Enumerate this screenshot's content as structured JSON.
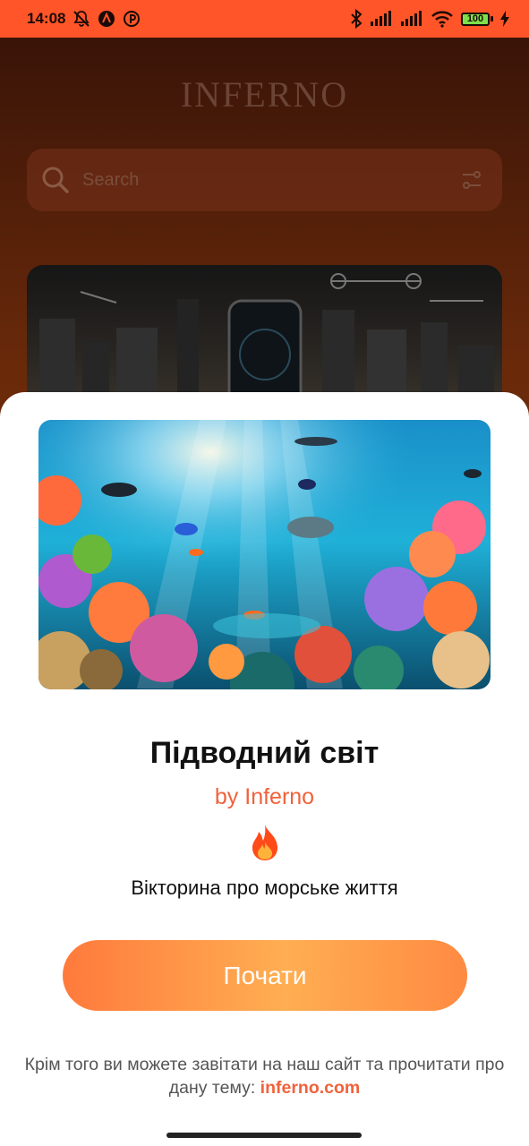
{
  "status_bar": {
    "time": "14:08",
    "battery": "100",
    "icons": [
      "mute-bell-icon",
      "alert-icon",
      "pinterest-icon",
      "bluetooth-icon",
      "signal-icon",
      "signal-icon",
      "wifi-icon",
      "battery-icon",
      "charging-icon"
    ]
  },
  "background_app": {
    "title": "INFERNO",
    "search": {
      "placeholder": "Search"
    }
  },
  "sheet": {
    "hero_image": "underwater-coral-reef-image",
    "title": "Підводний світ",
    "author": "by Inferno",
    "emoji": "🔥",
    "description": "Вікторина про морське життя",
    "start_label": "Почати",
    "footer_text": "Крім того ви можете завітати на наш сайт та прочитати про дану тему: ",
    "footer_link": "inferno.com"
  },
  "colors": {
    "status_bar": "#ff5528",
    "accent": "#f0623b",
    "button_start": "#ff7a3c",
    "button_end": "#ffae52"
  }
}
